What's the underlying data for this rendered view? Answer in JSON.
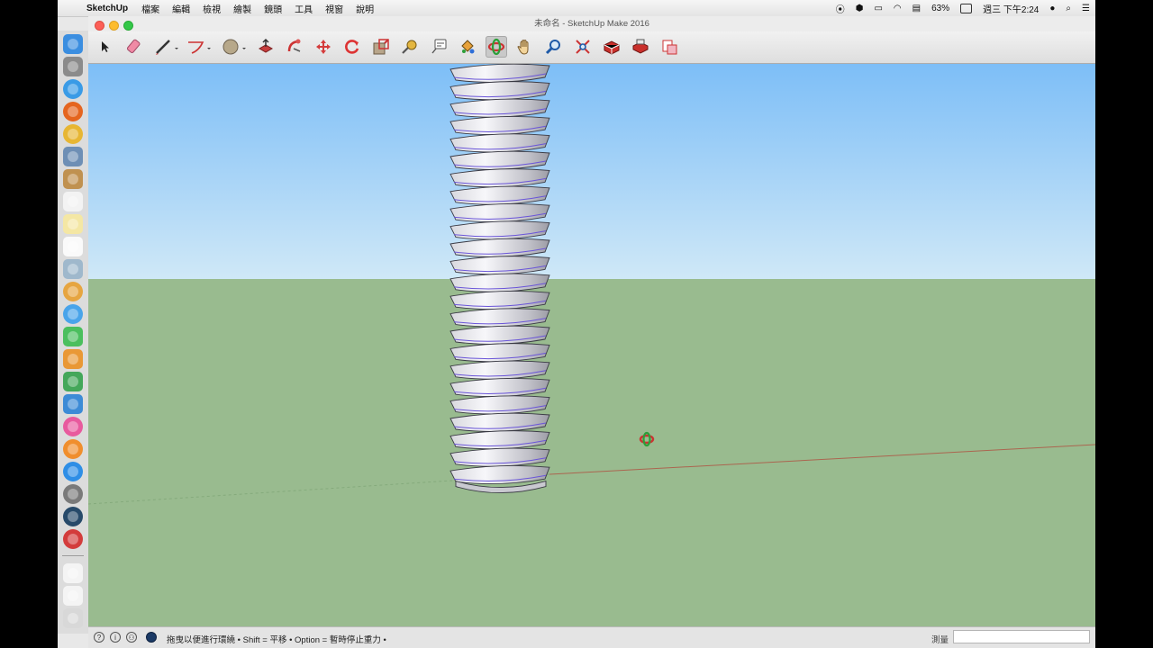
{
  "menubar": {
    "app_name": "SketchUp",
    "menus": [
      "檔案",
      "編輯",
      "檢視",
      "繪製",
      "鏡頭",
      "工具",
      "視窗",
      "說明"
    ],
    "battery": "63%",
    "clock": "週三 下午2:24"
  },
  "window": {
    "title": "未命名 - SketchUp Make 2016"
  },
  "toolbar": {
    "tools": [
      "select-tool",
      "eraser-tool",
      "line-tool",
      "arc-tool",
      "shapes-tool",
      "push-pull-tool",
      "follow-me-tool",
      "move-tool",
      "rotate-tool",
      "scale-tool",
      "tape-measure-tool",
      "text-tool",
      "paint-bucket-tool",
      "orbit-tool",
      "pan-tool",
      "zoom-tool",
      "zoom-extents-tool",
      "3d-warehouse-tool",
      "extension-warehouse-tool",
      "layout-tool"
    ],
    "active_tool": "orbit-tool"
  },
  "status": {
    "hint": "拖曳以便進行環繞 • Shift = 平移 • Option = 暫時停止重力 •",
    "measure_label": "測量",
    "measure_value": ""
  },
  "colors": {
    "sky_top": "#7dbef7",
    "sky_bottom": "#cfe8f7",
    "ground": "#99bb8f",
    "thread_edge": "#6a55d8",
    "red_axis": "#b05040"
  },
  "dock": {
    "apps": [
      "finder",
      "launchpad",
      "safari",
      "firefox",
      "chrome",
      "preview",
      "contacts",
      "calendar",
      "notes",
      "reminders",
      "photo-booth",
      "photos",
      "messages",
      "facetime",
      "pages",
      "numbers",
      "keynote",
      "itunes",
      "ibooks",
      "app-store",
      "system-preferences",
      "quicktime",
      "sketchup",
      "downloads",
      "documents",
      "trash"
    ]
  }
}
